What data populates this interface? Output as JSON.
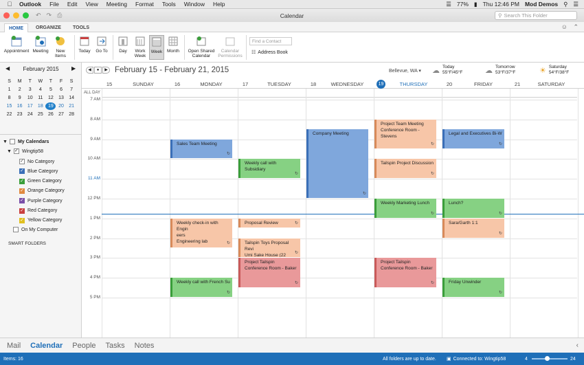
{
  "menubar": {
    "app": "Outlook",
    "items": [
      "File",
      "Edit",
      "View",
      "Meeting",
      "Format",
      "Tools",
      "Window",
      "Help"
    ],
    "battery": "77%",
    "clock": "Thu 12:46 PM",
    "user": "Mod Demos"
  },
  "window": {
    "title": "Calendar",
    "search_placeholder": "Search This Folder"
  },
  "ribbon_tabs": [
    "HOME",
    "ORGANIZE",
    "TOOLS"
  ],
  "ribbon": {
    "appointment": "Appointment",
    "meeting": "Meeting",
    "new_items": "New Items",
    "today": "Today",
    "goto": "Go To",
    "day": "Day",
    "work_week": "Work Week",
    "week": "Week",
    "month": "Month",
    "open_shared": "Open Shared Calendar",
    "cal_permissions": "Calendar Permissions",
    "find_contact": "Find a Contact",
    "address_book": "Address Book"
  },
  "mini_cal": {
    "title": "February 2015",
    "dow": [
      "S",
      "M",
      "T",
      "W",
      "T",
      "F",
      "S"
    ],
    "weeks": [
      [
        "1",
        "2",
        "3",
        "4",
        "5",
        "6",
        "7"
      ],
      [
        "8",
        "9",
        "10",
        "11",
        "12",
        "13",
        "14"
      ],
      [
        "15",
        "16",
        "17",
        "18",
        "19",
        "20",
        "21"
      ],
      [
        "22",
        "23",
        "24",
        "25",
        "26",
        "27",
        "28"
      ]
    ],
    "selected": "19"
  },
  "calendars": {
    "header": "My Calendars",
    "account": "Wingtip58",
    "categories": [
      {
        "label": "No Category",
        "color": "#ffffff"
      },
      {
        "label": "Blue Category",
        "color": "#3a6fb8"
      },
      {
        "label": "Green Category",
        "color": "#3a9e3a"
      },
      {
        "label": "Orange Category",
        "color": "#e08a40"
      },
      {
        "label": "Purple Category",
        "color": "#7a4fa8"
      },
      {
        "label": "Red Category",
        "color": "#c94040"
      },
      {
        "label": "Yellow Category",
        "color": "#e0c020"
      }
    ],
    "on_my_computer": "On My Computer",
    "smart_folders": "SMART FOLDERS"
  },
  "cal": {
    "range": "February 15 - February 21, 2015",
    "location": "Bellevue, WA",
    "weather": [
      {
        "label": "Today",
        "temp": "55°F/45°F"
      },
      {
        "label": "Tomorrow",
        "temp": "53°F/37°F"
      },
      {
        "label": "Saturday",
        "temp": "54°F/38°F"
      }
    ],
    "days": [
      {
        "num": "15",
        "name": "SUNDAY"
      },
      {
        "num": "16",
        "name": "MONDAY"
      },
      {
        "num": "17",
        "name": "TUESDAY"
      },
      {
        "num": "18",
        "name": "WEDNESDAY"
      },
      {
        "num": "19",
        "name": "THURSDAY"
      },
      {
        "num": "20",
        "name": "FRIDAY"
      },
      {
        "num": "21",
        "name": "SATURDAY"
      }
    ],
    "all_day": "ALL DAY",
    "times": [
      "7 AM",
      "8 AM",
      "9 AM",
      "10 AM",
      "11 AM",
      "12 PM",
      "1 PM",
      "2 PM",
      "3 PM",
      "4 PM",
      "5 PM"
    ],
    "events": [
      {
        "day": 1,
        "start": 9.0,
        "end": 10.0,
        "color": "blue",
        "line1": "Sales Team Meeting",
        "line2": ""
      },
      {
        "day": 1,
        "start": 13.0,
        "end": 14.5,
        "color": "orange",
        "line1": "Weekly check-in with Engin",
        "line2": "eers",
        "line3": "Engineering lab"
      },
      {
        "day": 1,
        "start": 16.0,
        "end": 17.0,
        "color": "green",
        "line1": "Weekly call with French Su",
        "line2": ""
      },
      {
        "day": 2,
        "start": 10.0,
        "end": 11.0,
        "color": "green",
        "line1": "Weekly call with Subsidiary",
        "line2": ""
      },
      {
        "day": 2,
        "start": 13.0,
        "end": 13.5,
        "color": "orange",
        "line1": "Proposal Review",
        "line2": ""
      },
      {
        "day": 2,
        "start": 14.0,
        "end": 15.0,
        "color": "orange",
        "line1": "Tailspin Toys Proposal Revi",
        "line2": "Umi Sake House (22"
      },
      {
        "day": 2,
        "start": 15.0,
        "end": 16.5,
        "color": "red",
        "line1": "Project Tailspin",
        "line2": "Conference Room - Baker"
      },
      {
        "day": 3,
        "start": 8.5,
        "end": 12.0,
        "color": "blue",
        "line1": "Company Meeting",
        "line2": ""
      },
      {
        "day": 4,
        "start": 8.0,
        "end": 9.5,
        "color": "orange",
        "line1": "Project Team Meeting",
        "line2": "Conference Room - Stevens"
      },
      {
        "day": 4,
        "start": 10.0,
        "end": 11.0,
        "color": "orange",
        "line1": "Tailspin Project Discussion",
        "line2": ""
      },
      {
        "day": 4,
        "start": 12.0,
        "end": 13.0,
        "color": "green",
        "line1": "Weekly Marketing Lunch",
        "line2": ""
      },
      {
        "day": 4,
        "start": 15.0,
        "end": 16.5,
        "color": "red",
        "line1": "Project Tailspin",
        "line2": "Conference Room - Baker"
      },
      {
        "day": 5,
        "start": 8.5,
        "end": 9.5,
        "color": "blue",
        "line1": "Legal and Executives Bi-W",
        "line2": ""
      },
      {
        "day": 5,
        "start": 12.0,
        "end": 13.0,
        "color": "green",
        "line1": "Lunch?",
        "line2": ""
      },
      {
        "day": 5,
        "start": 13.0,
        "end": 14.0,
        "color": "orange",
        "line1": "Sara/Garth 1:1",
        "line2": ""
      },
      {
        "day": 5,
        "start": 16.0,
        "end": 17.0,
        "color": "green",
        "line1": "Friday Unwinder",
        "line2": ""
      }
    ]
  },
  "navbar": [
    "Mail",
    "Calendar",
    "People",
    "Tasks",
    "Notes"
  ],
  "status": {
    "items": "Items: 16",
    "sync": "All folders are up to date.",
    "connected": "Connected to: Wingtip58",
    "zoom_min": "4",
    "zoom_max": "24"
  },
  "colors": {
    "accent": "#1f6fb8"
  }
}
